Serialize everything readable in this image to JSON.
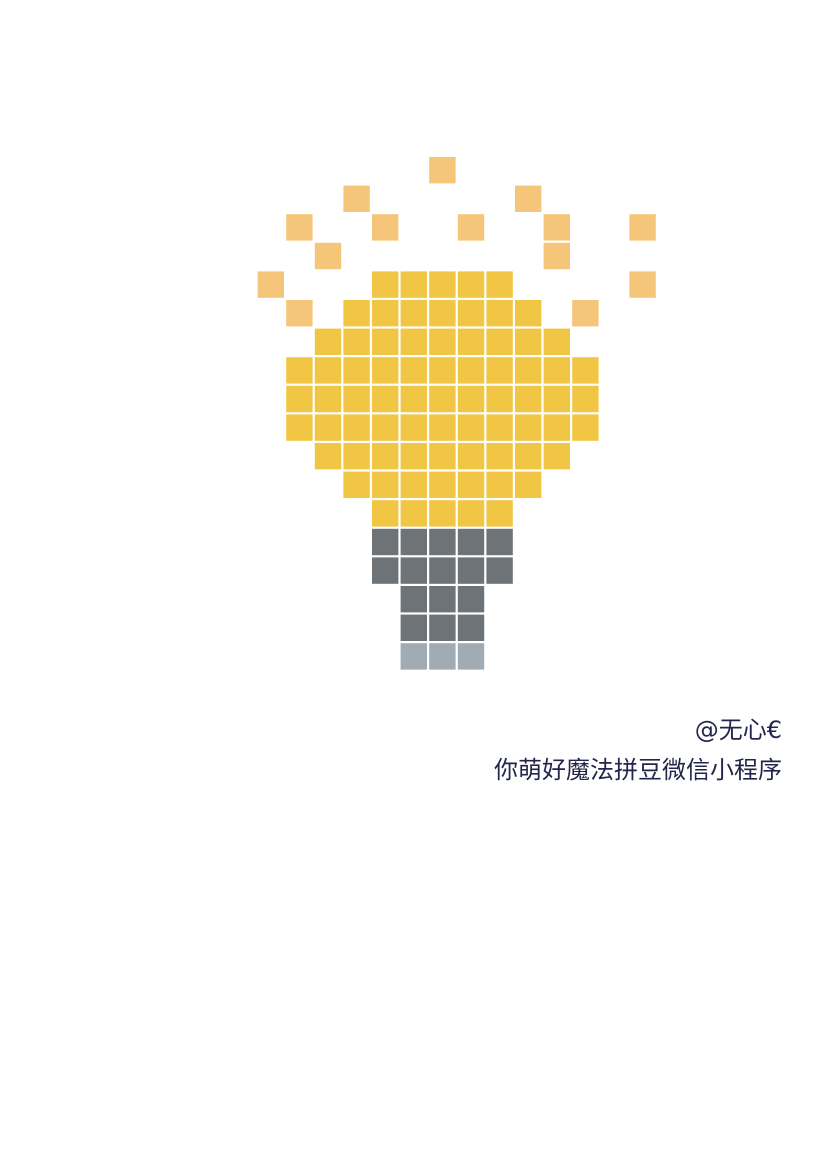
{
  "credit": {
    "author": "@无心€",
    "tagline": "你萌好魔法拼豆微信小程序"
  },
  "colors": {
    "background": "#ffffff",
    "ray": "#f5c67a",
    "glass": "#f1c644",
    "base": "#6e7378",
    "tip": "#a1abb3",
    "text": "#23264a"
  },
  "pixel_art": {
    "subject": "light-bulb",
    "rows": [
      ".......R.......",
      "....R.....R....",
      "..R..R..R..R..R",
      "...R.......R...",
      ".R...YYYYY....R",
      "..R.YYYYYYY.R..",
      "...YYYYYYYYY...",
      "..YYYYYYYYYYY..",
      "..YYYYYYYYYYY..",
      "..YYYYYYYYYYY..",
      "...YYYYYYYYY...",
      "....YYYYYYY....",
      ".....YYYYY.....",
      ".....GGGGG.....",
      ".....GGGGG.....",
      "......GGG......",
      "......GGG......",
      "......LLL......"
    ],
    "legend": {
      "R": "ray",
      "Y": "glass",
      "G": "base",
      "L": "tip"
    }
  }
}
